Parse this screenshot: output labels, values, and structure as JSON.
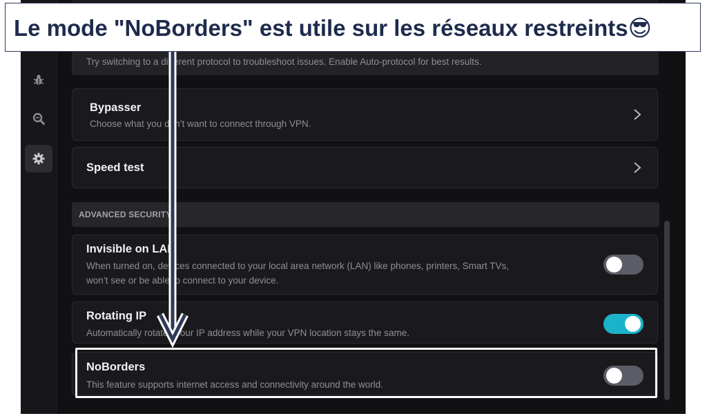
{
  "banner": {
    "text": "Le mode \"NoBorders\" est utile sur les réseaux restreints😎"
  },
  "sidebar": {
    "items": [
      {
        "icon": "bug-icon",
        "active": false
      },
      {
        "icon": "search-icon",
        "active": false
      },
      {
        "icon": "gear-icon",
        "active": true
      }
    ]
  },
  "protocol": {
    "description": "Try switching to a different protocol to troubleshoot issues. Enable Auto-protocol for best results."
  },
  "bypasser": {
    "title": "Bypasser",
    "description": "Choose what you don’t want to connect through VPN."
  },
  "speed_test": {
    "title": "Speed test"
  },
  "advanced_security": {
    "header": "ADVANCED SECURITY"
  },
  "invisible_lan": {
    "title": "Invisible on LAN",
    "description_line1": "When turned on, devices connected to your local area network (LAN) like phones, printers, Smart TVs,",
    "description_line2": "won’t see or be able to connect to your device.",
    "enabled": false
  },
  "rotating_ip": {
    "title": "Rotating IP",
    "description": "Automatically rotates your IP address while your VPN location stays the same.",
    "enabled": true
  },
  "noborders": {
    "title": "NoBorders",
    "description": "This feature supports internet access and connectivity around the world.",
    "enabled": false
  },
  "colors": {
    "toggle_on": "#1bb3c9",
    "toggle_off": "#5a5d66",
    "banner_text": "#1e2b4d"
  }
}
